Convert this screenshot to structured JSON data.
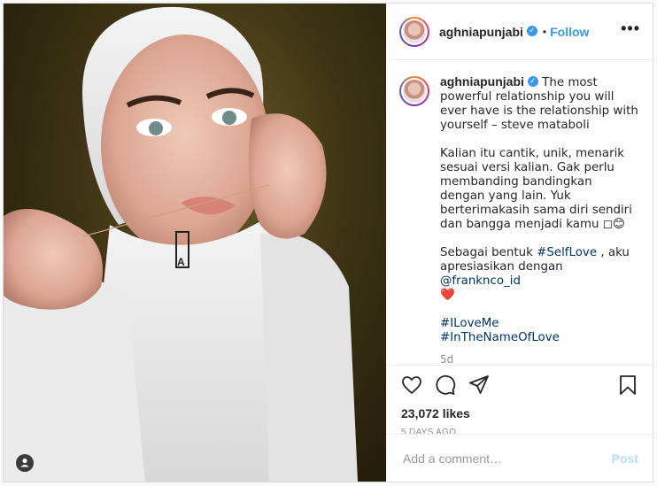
{
  "post": {
    "username": "aghniapunjabi",
    "follow_label": "Follow",
    "more_label": "•••",
    "caption_lines_first": "The most powerful relationship you will ever have is the relationship with yourself – steve mataboli",
    "caption_p2": "Kalian itu cantik, unik, menarik sesuai versi kalian. Gak perlu membanding bandingkan dengan yang lain. Yuk berterimakasih sama diri sendiri dan bangga menjadi kamu ◻😊",
    "caption_p3_a": "Sebagai bentuk ",
    "caption_p3_tag": "#SelfLove",
    "caption_p3_b": " , aku apresiasikan dengan ",
    "caption_p3_mention": "@franknco_id",
    "caption_p3_heart": "❤️",
    "hashtag1": "#ILoveMe",
    "hashtag2": "#InTheNameOfLove",
    "caption_age": "5d",
    "likes": "23,072 likes",
    "date": "5 DAYS AGO",
    "comment_placeholder": "Add a comment…",
    "post_label": "Post"
  },
  "icons": {
    "like": "heart-icon",
    "comment": "comment-icon",
    "share": "share-icon",
    "save": "bookmark-icon",
    "verified": "verified-badge-icon",
    "user_tag": "user-tag-icon"
  },
  "colors": {
    "accent": "#3897f0",
    "post_disabled": "#b2dffc",
    "link": "#003569"
  }
}
